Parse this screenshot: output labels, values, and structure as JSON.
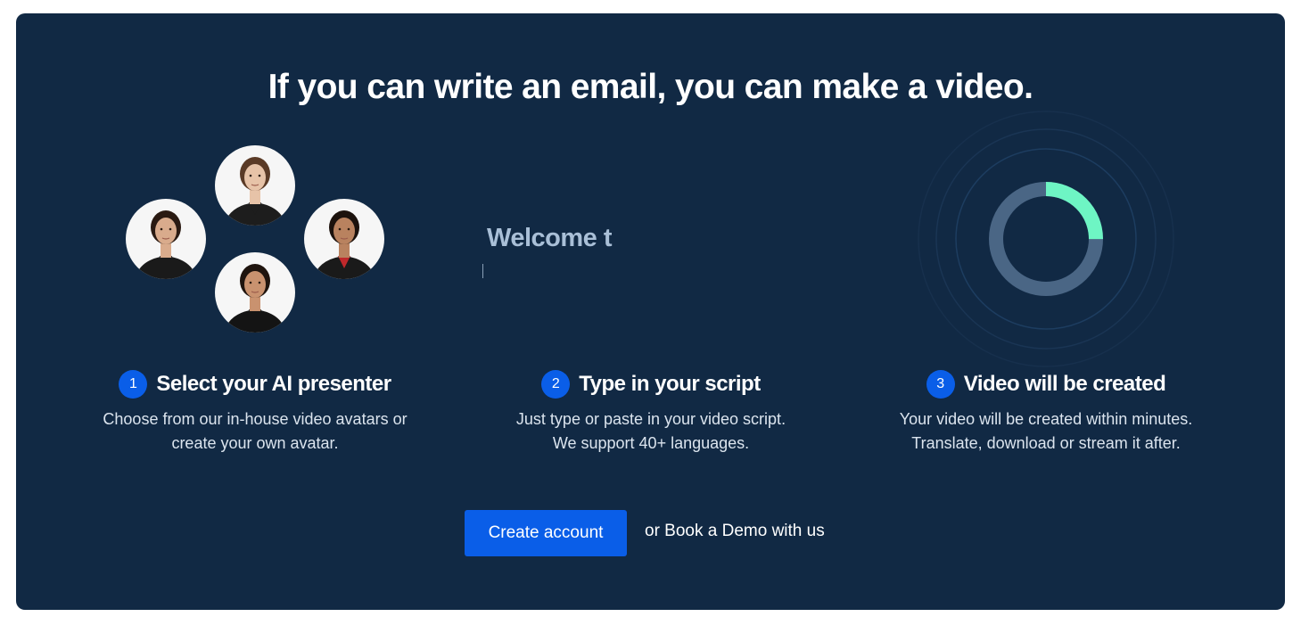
{
  "headline": "If you can write an email, you can make a video.",
  "typing_demo": {
    "text": "Welcome t"
  },
  "avatars": [
    {
      "name": "presenter-top",
      "hair": "#5a3a26",
      "skin": "#e7c3a8",
      "top": "#1d1d1d",
      "accent": "#1d1d1d"
    },
    {
      "name": "presenter-left",
      "hair": "#2a1a12",
      "skin": "#d9ab8c",
      "top": "#1a1a1a",
      "accent": "#1a1a1a"
    },
    {
      "name": "presenter-right",
      "hair": "#1c120d",
      "skin": "#b9825f",
      "top": "#1a1a1a",
      "accent": "#c0282b"
    },
    {
      "name": "presenter-bottom",
      "hair": "#1f140e",
      "skin": "#c9926f",
      "top": "#141414",
      "accent": "#141414"
    }
  ],
  "progress": {
    "fraction": 0.25,
    "track_color": "#4a6685",
    "fill_color": "#6ef5c4"
  },
  "steps": [
    {
      "number": "1",
      "title": "Select your AI presenter",
      "description_line1": "Choose from our in-house video avatars or",
      "description_line2": "create your own avatar."
    },
    {
      "number": "2",
      "title": "Type in your script",
      "description_line1": "Just type or paste in your video script.",
      "description_line2": "We support 40+ languages."
    },
    {
      "number": "3",
      "title": "Video will be created",
      "description_line1": "Your video will be created within minutes.",
      "description_line2": "Translate, download or stream it after."
    }
  ],
  "cta": {
    "create_account": "Create account",
    "book_demo": "or Book a Demo with us"
  },
  "colors": {
    "panel_bg": "#112944",
    "accent_blue": "#0a5ee8"
  }
}
